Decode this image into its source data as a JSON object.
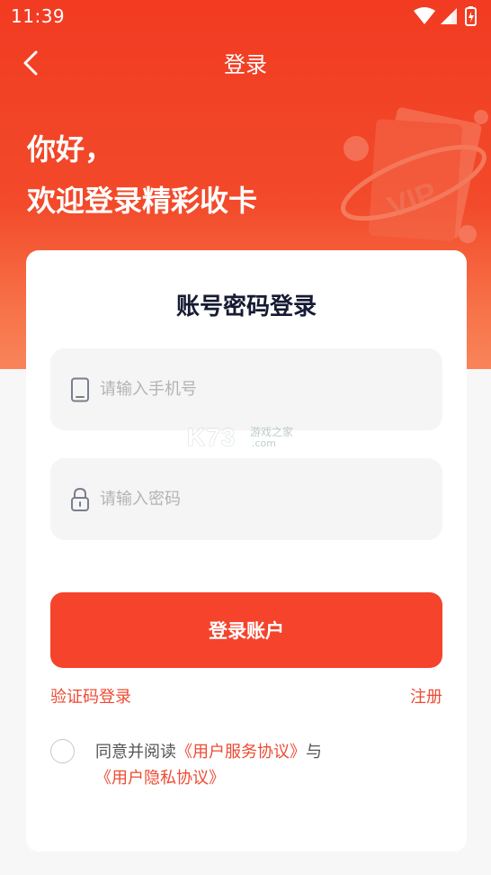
{
  "status_bar": {
    "time": "11:39"
  },
  "nav": {
    "title": "登录"
  },
  "hero": {
    "greeting_line1": "你好，",
    "greeting_line2": "欢迎登录精彩收卡"
  },
  "card": {
    "title": "账号密码登录",
    "phone_placeholder": "请输入手机号",
    "password_placeholder": "请输入密码",
    "login_button": "登录账户",
    "code_login_link": "验证码登录",
    "register_link": "注册",
    "agreement": {
      "prefix": "同意并阅读",
      "service_link": "《用户服务协议》",
      "connector": "与",
      "privacy_link": "《用户隐私协议》"
    }
  },
  "watermark": {
    "logo": "K73",
    "line1": "游戏之家",
    "line2": ".com"
  },
  "colors": {
    "brand_red": "#f5432c",
    "link_red": "#ef4a33",
    "hero_top": "#f23b22"
  }
}
